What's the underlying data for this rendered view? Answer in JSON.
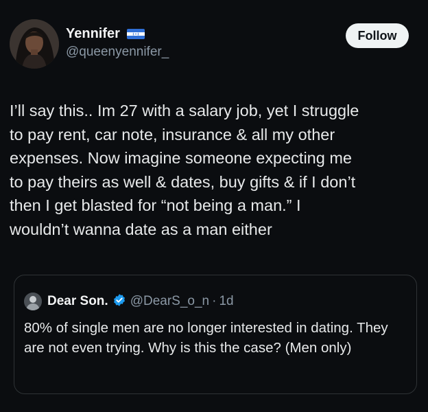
{
  "author": {
    "display_name": "Yennifer",
    "handle": "@queenyennifer_",
    "avatar_icon": "profile-photo",
    "flag_icon": "honduras-flag"
  },
  "follow_label": "Follow",
  "tweet_text": "I’ll say this.. Im 27 with a salary job, yet I struggle\nto pay rent, car note, insurance & all my other\nexpenses. Now imagine someone expecting me\nto pay theirs as well & dates, buy gifts & if I don’t\nthen I get blasted for “not being a man.” I\nwouldn’t wanna date as a man either",
  "quoted": {
    "display_name": "Dear Son.",
    "verified_icon": "verified-badge",
    "handle": "@DearS_o_n",
    "separator": "·",
    "time": "1d",
    "text": "80% of single men are no longer interested in dating. They are not even trying. Why is this the case? (Men only)"
  },
  "colors": {
    "background": "#0b0d10",
    "text": "#e7e9ea",
    "muted": "#8b98a5",
    "verified": "#1d9bf0",
    "border": "#2f3336"
  }
}
